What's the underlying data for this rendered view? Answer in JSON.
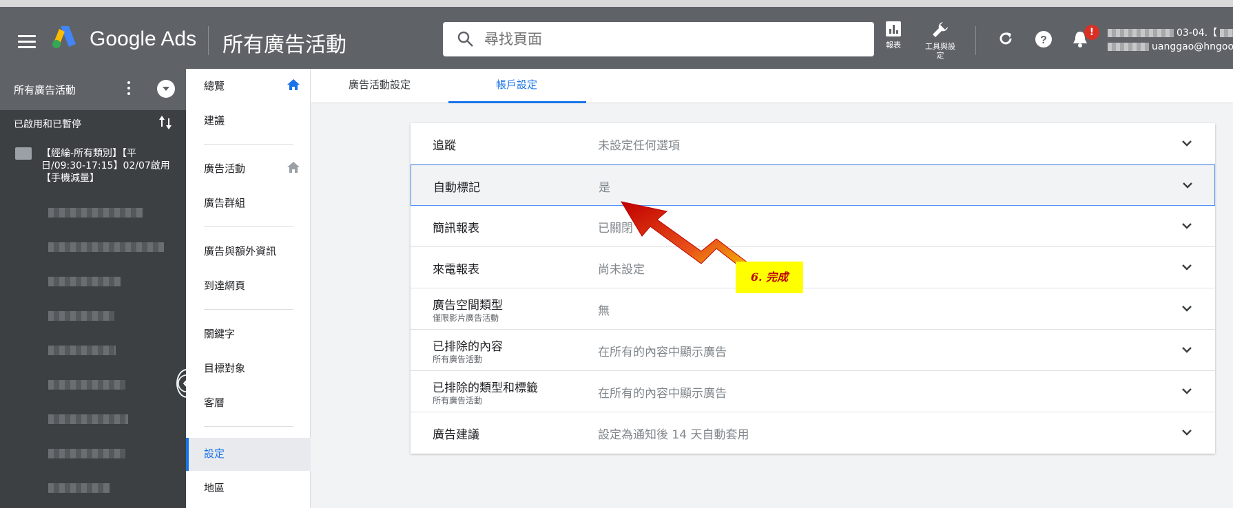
{
  "topbar": {
    "brand": "Google Ads",
    "page_title": "所有廣告活動",
    "search_placeholder": "尋找頁面",
    "reports_label": "報表",
    "tools_label": "工具與設定",
    "account_line1": "03-04.【",
    "account_line2": "uanggao@hngoog",
    "notification_badge": "!"
  },
  "left_nav": {
    "header": "所有廣告活動",
    "filter": "已啟用和已暫停",
    "campaign": "【經綸-所有類別】【平日/09:30-17:15】02/07啟用【手機減量】"
  },
  "side_nav": {
    "items": [
      "總覽",
      "建議",
      "廣告活動",
      "廣告群組",
      "廣告與額外資訊",
      "到達網頁",
      "關鍵字",
      "目標對象",
      "客層",
      "設定",
      "地區"
    ]
  },
  "tabs": [
    "廣告活動設定",
    "帳戶設定"
  ],
  "settings": [
    {
      "key": "追蹤",
      "sub": "",
      "value": "未設定任何選項"
    },
    {
      "key": "自動標記",
      "sub": "",
      "value": "是"
    },
    {
      "key": "簡訊報表",
      "sub": "",
      "value": "已關閉"
    },
    {
      "key": "來電報表",
      "sub": "",
      "value": "尚未設定"
    },
    {
      "key": "廣告空間類型",
      "sub": "僅限影片廣告活動",
      "value": "無"
    },
    {
      "key": "已排除的內容",
      "sub": "所有廣告活動",
      "value": "在所有的內容中顯示廣告"
    },
    {
      "key": "已排除的類型和標籤",
      "sub": "所有廣告活動",
      "value": "在所有的內容中顯示廣告"
    },
    {
      "key": "廣告建議",
      "sub": "",
      "value": "設定為通知後 14 天自動套用"
    }
  ],
  "annotation": "6. 完成",
  "colors": {
    "accent": "#1a73e8",
    "topbar": "#5f6368",
    "note_bg": "#ffff00",
    "note_text": "#bb0000"
  }
}
